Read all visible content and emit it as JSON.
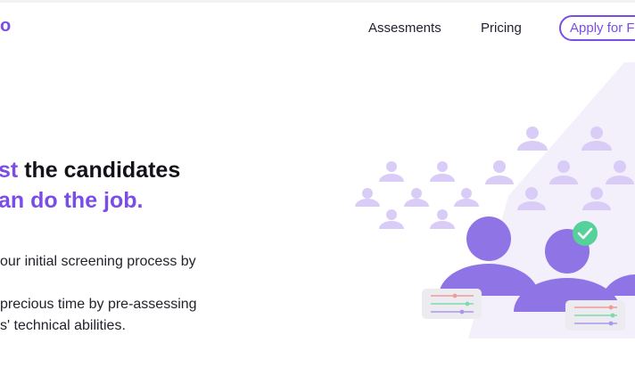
{
  "brand": {
    "logo_text": "o"
  },
  "nav": {
    "items": [
      "Assesments",
      "Pricing"
    ],
    "cta_label": "Apply for F"
  },
  "hero": {
    "headline_line1_accent": "st",
    "headline_line1_rest": "the candidates",
    "headline_line2_accent": "an do the job.",
    "body_line1": "our initial screening process by",
    "body_line2": "precious time by pre-assessing",
    "body_line3": "s' technical abilities."
  },
  "colors": {
    "accent": "#7b4de6",
    "accent_light": "#d9ccf7",
    "success": "#56d19a",
    "text_dark": "#121218"
  }
}
